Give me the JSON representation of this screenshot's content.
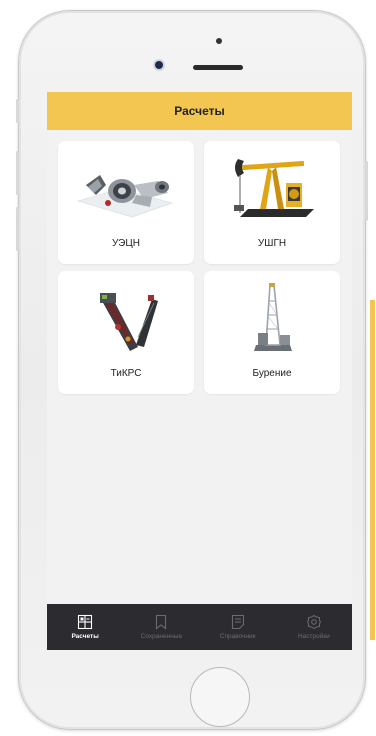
{
  "header": {
    "title": "Расчеты"
  },
  "cards": [
    {
      "label": "УЭЦН",
      "icon": "pump-components-icon"
    },
    {
      "label": "УШГН",
      "icon": "pumpjack-icon"
    },
    {
      "label": "ТиКРС",
      "icon": "workover-rig-icon"
    },
    {
      "label": "Бурение",
      "icon": "drilling-rig-icon"
    }
  ],
  "tabs": [
    {
      "label": "Расчеты",
      "icon": "grid-icon",
      "active": true
    },
    {
      "label": "Сохраненные",
      "icon": "bookmark-icon",
      "active": false
    },
    {
      "label": "Справочник",
      "icon": "document-icon",
      "active": false
    },
    {
      "label": "Настройки",
      "icon": "gear-icon",
      "active": false
    }
  ],
  "colors": {
    "accent": "#f3c551",
    "tabbar": "#2c2c30",
    "tab_inactive": "#6a6a70",
    "tab_active": "#ffffff",
    "screen_bg": "#f2f2f2"
  }
}
